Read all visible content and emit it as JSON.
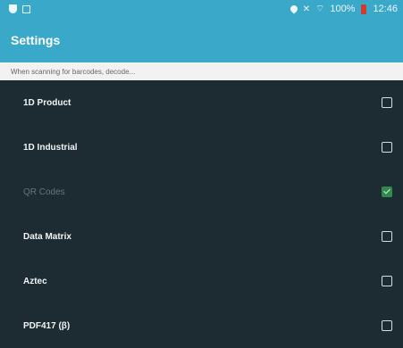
{
  "status_bar": {
    "left_icons": [
      "shield-icon",
      "screenshot-icon"
    ],
    "right_icons": [
      "location-icon",
      "no-signal-icon",
      "wifi-icon"
    ],
    "battery_percent": "100%",
    "battery_color": "#d23b2b",
    "time": "12:46"
  },
  "app_bar": {
    "title": "Settings",
    "color": "#3aa8c9"
  },
  "section_subtitle": "When scanning for barcodes, decode...",
  "options": [
    {
      "label": "1D Product",
      "checked": false,
      "enabled": true
    },
    {
      "label": "1D Industrial",
      "checked": false,
      "enabled": true
    },
    {
      "label": "QR Codes",
      "checked": true,
      "enabled": false
    },
    {
      "label": "Data Matrix",
      "checked": false,
      "enabled": true
    },
    {
      "label": "Aztec",
      "checked": false,
      "enabled": true
    },
    {
      "label": "PDF417 (β)",
      "checked": false,
      "enabled": true
    }
  ],
  "colors": {
    "background": "#1d2b33",
    "checked_green": "#2f8b49"
  }
}
